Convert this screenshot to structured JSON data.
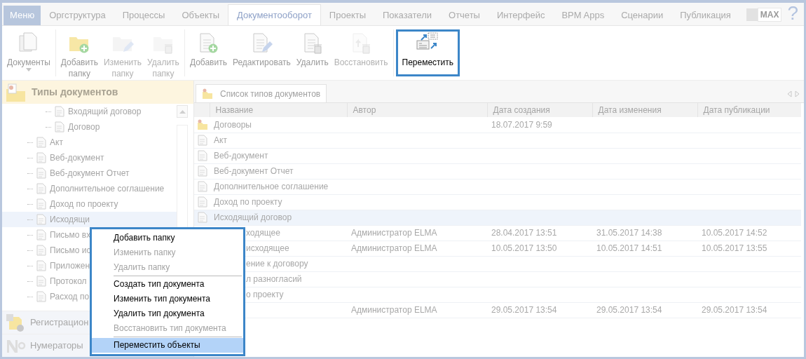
{
  "menu_button": "Меню",
  "tabs": [
    {
      "label": "Оргструктура",
      "selected": false
    },
    {
      "label": "Процессы",
      "selected": false
    },
    {
      "label": "Объекты",
      "selected": false
    },
    {
      "label": "Документооборот",
      "selected": true
    },
    {
      "label": "Проекты",
      "selected": false
    },
    {
      "label": "Показатели",
      "selected": false
    },
    {
      "label": "Отчеты",
      "selected": false
    },
    {
      "label": "Интерфейс",
      "selected": false
    },
    {
      "label": "BPM Apps",
      "selected": false
    },
    {
      "label": "Сценарии",
      "selected": false
    },
    {
      "label": "Публикация",
      "selected": false
    }
  ],
  "max_toggle": "MAX",
  "help": "?",
  "ribbon": {
    "groups": [
      {
        "buttons": [
          {
            "label": "Документы",
            "disabled": false,
            "highlighted": false,
            "dropdown": true
          }
        ]
      },
      {
        "buttons": [
          {
            "label": "Добавить папку",
            "disabled": false,
            "highlighted": false
          },
          {
            "label": "Изменить папку",
            "disabled": true,
            "highlighted": false
          },
          {
            "label": "Удалить папку",
            "disabled": true,
            "highlighted": false
          }
        ]
      },
      {
        "buttons": [
          {
            "label": "Добавить",
            "disabled": false,
            "highlighted": false
          },
          {
            "label": "Редактировать",
            "disabled": false,
            "highlighted": false
          },
          {
            "label": "Удалить",
            "disabled": false,
            "highlighted": false
          },
          {
            "label": "Восстановить",
            "disabled": true,
            "highlighted": false
          }
        ]
      },
      {
        "buttons": [
          {
            "label": "Переместить",
            "disabled": false,
            "highlighted": true
          }
        ]
      }
    ]
  },
  "left_panel": {
    "title": "Типы документов",
    "tree": {
      "items": [
        {
          "children": [
            {
              "label": "Входящий договор",
              "selected": false
            },
            {
              "label": "Договор",
              "selected": false
            }
          ]
        },
        {
          "label": "Акт",
          "selected": false
        },
        {
          "label": "Веб-документ",
          "selected": false
        },
        {
          "label": "Веб-документ Отчет",
          "selected": false
        },
        {
          "label": "Дополнительное соглашение",
          "selected": false
        },
        {
          "label": "Доход по проекту",
          "selected": false
        },
        {
          "label": "Исходящи",
          "selected": true
        },
        {
          "label": "Письмо вх",
          "selected": false
        },
        {
          "label": "Письмо ис",
          "selected": false
        },
        {
          "label": "Приложен",
          "selected": false
        },
        {
          "label": "Протокол",
          "selected": false
        },
        {
          "label": "Расход по",
          "selected": false
        }
      ]
    },
    "sections": [
      "Регистрацион",
      "Нумераторы"
    ]
  },
  "content_tab": "Список типов документов",
  "table": {
    "columns": [
      "Название",
      "Автор",
      "Дата создания",
      "Дата изменения",
      "Дата публикации"
    ],
    "rows": [
      {
        "name": "Договоры",
        "created": "18.07.2017 9:59",
        "selected": false
      },
      {
        "name": "Акт",
        "selected": false
      },
      {
        "name": "Веб-документ",
        "selected": false
      },
      {
        "name": "Веб-документ Отчет",
        "selected": false
      },
      {
        "name": "Дополнительное соглашение",
        "selected": false
      },
      {
        "name": "Доход по проекту",
        "selected": false
      },
      {
        "name": "Исходящий договор",
        "selected": true
      },
      {
        "name": "ходящее",
        "clipped": true,
        "author": "Администратор ELMA",
        "created": "28.04.2017 13:51",
        "modified": "31.05.2017 14:38",
        "published": "10.05.2017 14:52",
        "selected": false
      },
      {
        "name": "исходящее",
        "clipped": true,
        "author": "Администратор ELMA",
        "created": "10.05.2017 13:50",
        "modified": "10.05.2017 14:51",
        "published": "10.05.2017 13:55",
        "selected": false
      },
      {
        "name": "ение к договору",
        "clipped": true,
        "selected": false
      },
      {
        "name": "л разногласий",
        "clipped": true,
        "selected": false
      },
      {
        "name": "о проекту",
        "clipped": true,
        "selected": false
      },
      {
        "clipped": true,
        "author": "Администратор ELMA",
        "created": "29.05.2017 13:54",
        "modified": "29.05.2017 13:54",
        "published": "29.05.2017 13:54",
        "selected": false
      }
    ]
  },
  "context_menu": {
    "items": [
      {
        "kind": "item",
        "label": "Добавить папку",
        "disabled": false,
        "selected": false
      },
      {
        "kind": "item",
        "label": "Изменить папку",
        "disabled": true,
        "selected": false
      },
      {
        "kind": "item",
        "label": "Удалить папку",
        "disabled": true,
        "selected": false
      },
      {
        "kind": "separator"
      },
      {
        "kind": "item",
        "label": "Создать тип документа",
        "disabled": false,
        "selected": false
      },
      {
        "kind": "item",
        "label": "Изменить тип документа",
        "disabled": false,
        "selected": false
      },
      {
        "kind": "item",
        "label": "Удалить тип документа",
        "disabled": false,
        "selected": false
      },
      {
        "kind": "item",
        "label": "Восстановить тип документа",
        "disabled": true,
        "selected": false
      },
      {
        "kind": "separator"
      },
      {
        "kind": "item",
        "label": "Переместить объекты",
        "disabled": false,
        "selected": true
      }
    ]
  }
}
